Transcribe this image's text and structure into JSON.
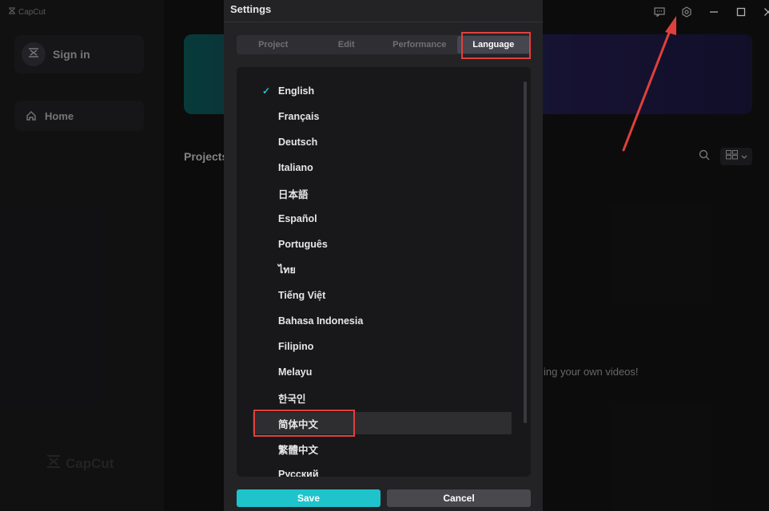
{
  "app": {
    "logo_small": "CapCut",
    "logo_watermark": "CapCut",
    "sidebar": {
      "signin_label": "Sign in",
      "home_label": "Home"
    },
    "main": {
      "projects_title": "Projects",
      "empty_hint": "ing your own videos!"
    },
    "titlebar_icons": [
      "feedback-icon",
      "settings-icon",
      "minimize-icon",
      "maximize-icon",
      "close-icon"
    ]
  },
  "dialog": {
    "title": "Settings",
    "tabs": [
      "Project",
      "Edit",
      "Performance",
      "Language"
    ],
    "active_tab": "Language",
    "languages": [
      "English",
      "Français",
      "Deutsch",
      "Italiano",
      "日本語",
      "Español",
      "Português",
      "ไทย",
      "Tiếng Việt",
      "Bahasa Indonesia",
      "Filipino",
      "Melayu",
      "한국인",
      "简体中文",
      "繁體中文",
      "Русский"
    ],
    "selected_language": "English",
    "highlighted_language": "简体中文",
    "save_label": "Save",
    "cancel_label": "Cancel"
  },
  "colors": {
    "accent": "#1fc3cc",
    "annotation": "#e0403c"
  }
}
